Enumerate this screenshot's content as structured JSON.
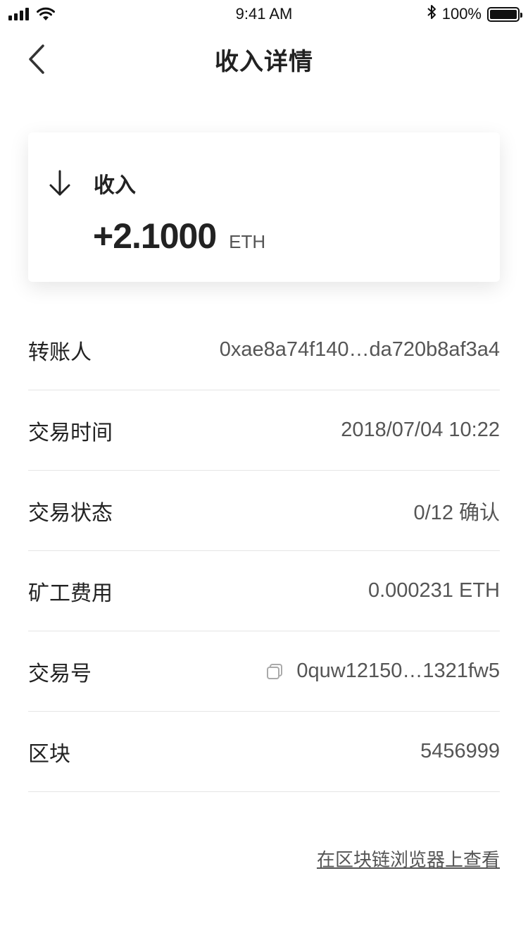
{
  "status_bar": {
    "time": "9:41 AM",
    "battery": "100%",
    "icons": [
      "signal-icon",
      "wifi-icon",
      "bluetooth-icon",
      "battery-icon"
    ]
  },
  "nav": {
    "title": "收入详情",
    "back_icon": "chevron-left-icon"
  },
  "card": {
    "icon": "arrow-down-icon",
    "label": "收入",
    "amount": "+2.1000",
    "unit": "ETH"
  },
  "details": [
    {
      "label": "转账人",
      "value": "0xae8a74f140…da720b8af3a4"
    },
    {
      "label": "交易时间",
      "value": "2018/07/04 10:22"
    },
    {
      "label": "交易状态",
      "value": "0/12 确认"
    },
    {
      "label": "矿工费用",
      "value": "0.000231 ETH"
    },
    {
      "label": "交易号",
      "value": "0quw12150…1321fw5",
      "icon": "copy-icon"
    },
    {
      "label": "区块",
      "value": "5456999"
    }
  ],
  "explorer_link": "在区块链浏览器上查看",
  "colors": {
    "text_primary": "#222222",
    "text_secondary": "#555555",
    "divider": "#e5e5e5",
    "background": "#ffffff"
  }
}
